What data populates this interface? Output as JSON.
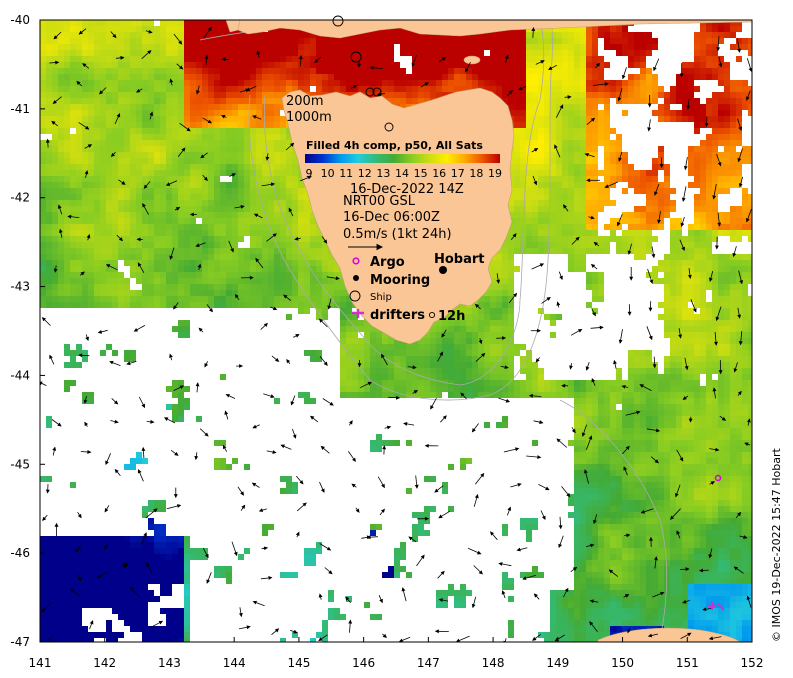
{
  "map": {
    "lon_range": [
      141,
      152
    ],
    "lat_range": [
      -47,
      -40
    ],
    "x_ticks": [
      "141",
      "142",
      "143",
      "144",
      "145",
      "146",
      "147",
      "148",
      "149",
      "150",
      "151",
      "152"
    ],
    "y_ticks": [
      "-40",
      "-41",
      "-42",
      "-43",
      "-44",
      "-45",
      "-46",
      "-47"
    ],
    "land_color": "#fbc696",
    "sea_gap_color": "#ffffff"
  },
  "contours": {
    "label_200": "200m",
    "label_1000": "1000m"
  },
  "legend": {
    "title": "Filled 4h comp, p50, All Sats",
    "scale_min": 9,
    "scale_max": 19,
    "scale_labels": [
      "9",
      "10",
      "11",
      "12",
      "13",
      "14",
      "15",
      "16",
      "17",
      "18",
      "19"
    ],
    "colormap": [
      "#00008b",
      "#0033cc",
      "#0099ee",
      "#22ccdd",
      "#33bb77",
      "#44aa33",
      "#88cc22",
      "#ccdd11",
      "#ffee00",
      "#ffaa00",
      "#ee5500",
      "#bb0000"
    ],
    "date_line": "16-Dec-2022 14Z",
    "current_source": "NRT00 GSL",
    "current_time": "16-Dec 06:00Z",
    "scale_arrow_label": "0.5m/s (1kt 24h)"
  },
  "markers": {
    "argo_label": "Argo",
    "mooring_label": "Mooring",
    "ship_label": "Ship",
    "drifters_label": "drifters",
    "drifters_suffix": "12h",
    "hobart_label": "Hobart",
    "argo_color": "#dd00dd",
    "drifter_color": "#cc33cc"
  },
  "credit": "© IMOS 19-Dec-2022 15:47 Hobart"
}
